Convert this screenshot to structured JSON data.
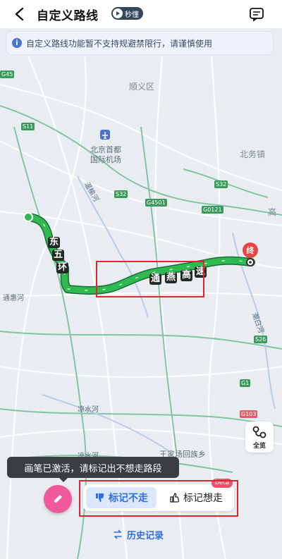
{
  "header": {
    "title": "自定义路线",
    "badge": "秒懂"
  },
  "notice": {
    "text": "自定义路线功能暂不支持规避禁限行，请谨慎使用"
  },
  "map": {
    "labels": {
      "shunyi": "顺义区",
      "airport_line1": "北京首都",
      "airport_line2": "国际机场",
      "beiwu": "北务镇",
      "gao": "高",
      "wenyu": "温榆河",
      "tonghui": "通惠河",
      "liangshui": "凉水河",
      "chaobai": "潮白河",
      "wangzhuang": "王家场回族乡",
      "liangshui2": "凉水河"
    },
    "roads": [
      "G45",
      "S11",
      "S32",
      "G4501",
      "G0121",
      "S32",
      "S26",
      "G1",
      "G103",
      "G0121"
    ],
    "route_labels": {
      "east_ring": [
        "东",
        "五",
        "环"
      ],
      "tongyan": [
        "通",
        "燕",
        "高",
        "速"
      ]
    },
    "end_label": "终"
  },
  "controls": {
    "overview_label": "全览",
    "tooltip": "画笔已激活，请标记出不想走路段",
    "mark_not_go": "标记不走",
    "mark_want_go": "标记想走",
    "beta": "beta",
    "history": "历史记录"
  },
  "colors": {
    "route": "#2fba4f",
    "accent": "#2f6fe0",
    "pen": "#f05a9a",
    "highlight": "#e0262c"
  }
}
